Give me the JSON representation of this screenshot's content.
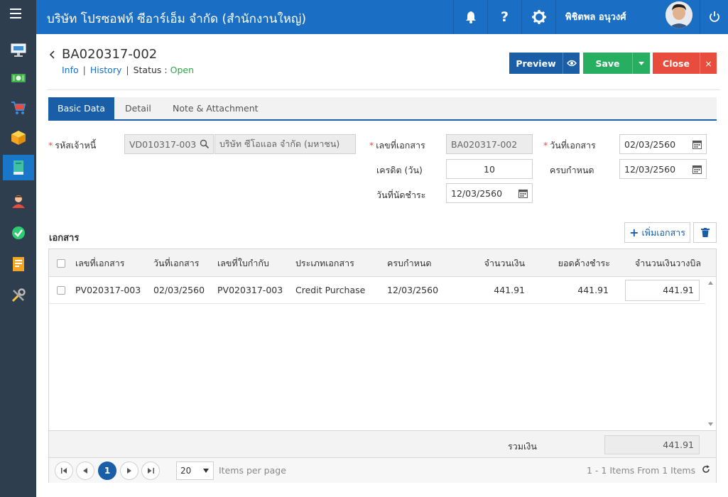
{
  "header": {
    "company": "บริษัท โปรซอฟท์ ซีอาร์เอ็ม จำกัด (สำนักงานใหญ่)",
    "user_name": "พิชิตพล อนุวงศ์"
  },
  "document": {
    "number": "BA020317-002",
    "links": {
      "info": "Info",
      "history": "History"
    },
    "status_label": "Status",
    "status_colon": ":",
    "status_value": "Open"
  },
  "toolbar": {
    "preview": "Preview",
    "save": "Save",
    "close": "Close",
    "close_x": "×"
  },
  "tabs": [
    {
      "label": "Basic Data",
      "active": true
    },
    {
      "label": "Detail",
      "active": false
    },
    {
      "label": "Note & Attachment",
      "active": false
    }
  ],
  "form": {
    "creditor_code": {
      "label": "รหัสเจ้าหนี้",
      "value": "VD010317-003",
      "name": "บริษัท ซีโอแอล จำกัด (มหาชน)"
    },
    "doc_no": {
      "label": "เลขที่เอกสาร",
      "value": "BA020317-002"
    },
    "credit_days": {
      "label": "เครดิต (วัน)",
      "value": "10"
    },
    "bill_date": {
      "label": "วันที่นัดชำระ",
      "value": "12/03/2560"
    },
    "doc_date": {
      "label": "วันที่เอกสาร",
      "value": "02/03/2560"
    },
    "due_date": {
      "label": "ครบกำหนด",
      "value": "12/03/2560"
    },
    "required_mark": "*"
  },
  "documents": {
    "title": "เอกสาร",
    "add_label": "เพิ่มเอกสาร",
    "columns": [
      "เลขที่เอกสาร",
      "วันที่เอกสาร",
      "เลขที่ใบกำกับ",
      "ประเภทเอกสาร",
      "ครบกำหนด",
      "จำนวนเงิน",
      "ยอดค้างชำระ",
      "จำนวนเงินวางบิล"
    ],
    "rows": [
      [
        "PV020317-003",
        "02/03/2560",
        "PV020317-003",
        "Credit Purchase",
        "12/03/2560",
        "441.91",
        "441.91",
        "441.91"
      ]
    ],
    "total_label": "รวมเงิน",
    "total_value": "441.91"
  },
  "pager": {
    "current_page": "1",
    "page_size": "20",
    "items_per_page": "Items per page",
    "info": "1 - 1 Items From 1 Items"
  },
  "colors": {
    "primary": "#1a5ea8",
    "header": "#1a6fc4",
    "save": "#27ae60",
    "close": "#e74c3c",
    "sidebar": "#2f3e4e",
    "status_open": "#2aa745"
  },
  "sidebar": {
    "icons": [
      "presentation-icon",
      "money-icon",
      "cart-icon",
      "box-icon",
      "book-icon",
      "person-icon",
      "check-icon",
      "report-icon",
      "tools-icon"
    ],
    "active_index": 4
  }
}
